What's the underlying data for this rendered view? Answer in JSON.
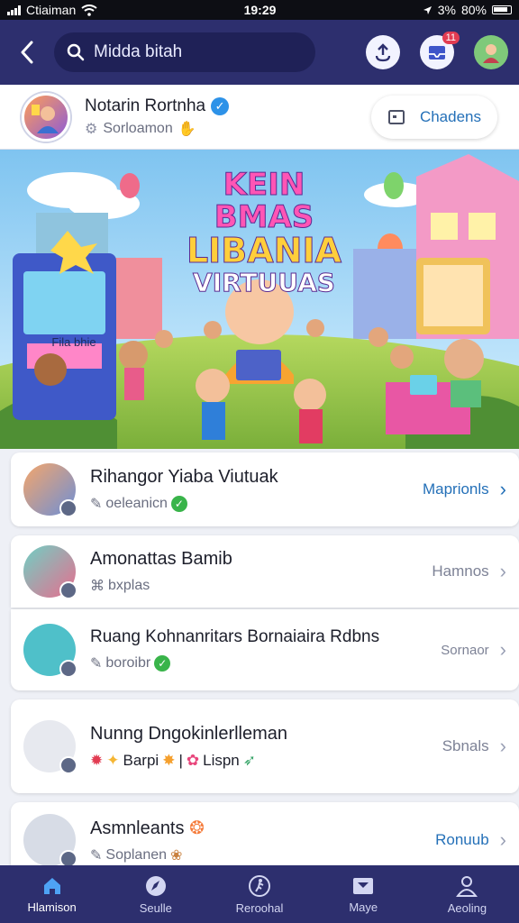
{
  "status_bar": {
    "carrier": "Ctiaiman",
    "time": "19:29",
    "battery": "80%",
    "battery_prefix": "3%"
  },
  "nav": {
    "search_value": "Midda bitah",
    "notification_count": "11"
  },
  "profile": {
    "name": "Notarin Rortnha",
    "subtitle": "Sorloamon",
    "button_label": "Chadens"
  },
  "banner": {
    "line1": "KEIN BMAS",
    "line2": "LIBANIA",
    "line3": "VIRTUUAS",
    "arcade_sign": "Fila bhie"
  },
  "list": [
    {
      "title": "Rihangor Yiaba Viutuak",
      "subtitle": "oeleanicn",
      "action": "Maprionls",
      "action_color": "#2470b8"
    },
    {
      "title": "Amonattas Bamib",
      "subtitle": "bxplas",
      "action": "Hamnos",
      "action_color": "#7d8296"
    },
    {
      "title": "Ruang Kohnanritars Bornaiaira Rdbns",
      "subtitle": "boroibr",
      "action": "Sornaor",
      "action_color": "#7d8296"
    },
    {
      "title": "Nunng Dngokinlerlleman",
      "subtitle_a": "Barpi",
      "subtitle_b": "Lispn",
      "action": "Sbnals",
      "action_color": "#7d8296"
    },
    {
      "title": "Asmnleants",
      "subtitle": "Soplanen",
      "action": "Ronuub",
      "action_color": "#2470b8"
    }
  ],
  "tabs": [
    {
      "label": "Hlamison",
      "icon": "home-icon",
      "active": true
    },
    {
      "label": "Seulle",
      "icon": "compass-icon"
    },
    {
      "label": "Reroohal",
      "icon": "activity-icon"
    },
    {
      "label": "Maye",
      "icon": "inbox-icon"
    },
    {
      "label": "Aeoling",
      "icon": "person-icon"
    }
  ]
}
